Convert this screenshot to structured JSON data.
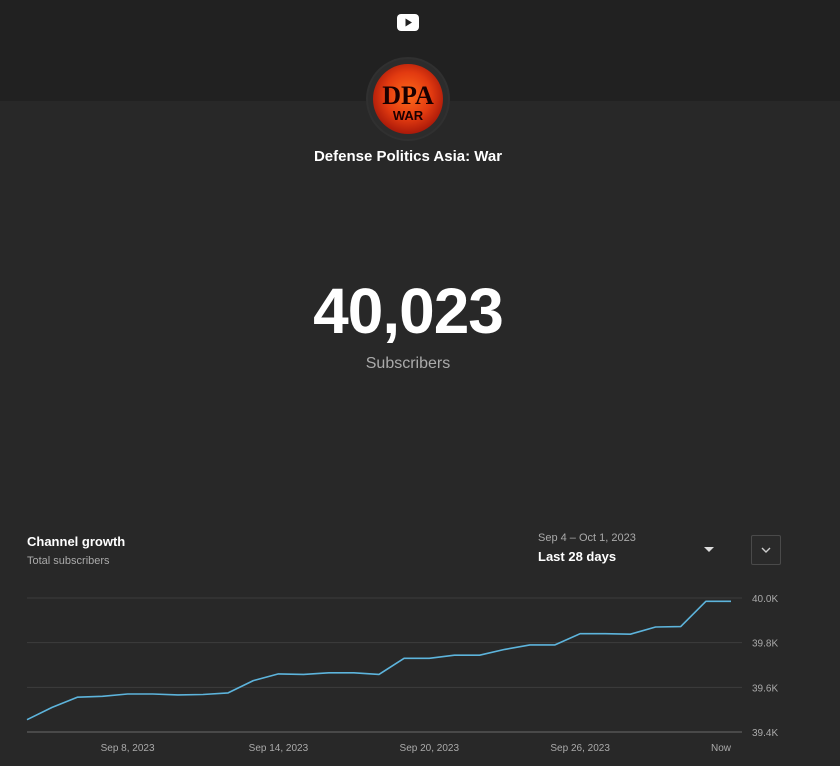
{
  "channel": {
    "name": "Defense Politics Asia: War",
    "avatar_text_top": "DPA",
    "avatar_text_bottom": "WAR"
  },
  "stats": {
    "subscriber_count": "40,023",
    "subscriber_label": "Subscribers"
  },
  "growth": {
    "title": "Channel growth",
    "subtitle": "Total subscribers",
    "date_range": "Sep 4 – Oct 1, 2023",
    "period_label": "Last 28 days"
  },
  "icons": {
    "logo": "youtube-play-icon",
    "period_dropdown": "caret-down-icon",
    "expand": "chevron-down-icon"
  },
  "colors": {
    "background": "#282828",
    "topbar": "#212121",
    "line": "#5db4dc",
    "grid": "#3d3d3d",
    "muted_text": "#aaaaaa"
  },
  "chart_data": {
    "type": "line",
    "title": "Channel growth",
    "subtitle": "Total subscribers",
    "xlabel": "",
    "ylabel": "",
    "ylim": [
      39400,
      40000
    ],
    "y_ticks": [
      "40.0K",
      "39.8K",
      "39.6K",
      "39.4K"
    ],
    "y_tick_values": [
      40000,
      39800,
      39600,
      39400
    ],
    "x_ticks": [
      "Sep 8, 2023",
      "Sep 14, 2023",
      "Sep 20, 2023",
      "Sep 26, 2023",
      "Now"
    ],
    "x_tick_index": [
      4,
      10,
      16,
      22,
      27.6
    ],
    "grid": true,
    "series": [
      {
        "values": [
          39455,
          39510,
          39556,
          39560,
          39570,
          39570,
          39566,
          39568,
          39575,
          39630,
          39660,
          39658,
          39665,
          39665,
          39658,
          39730,
          39730,
          39744,
          39744,
          39770,
          39790,
          39790,
          39840,
          39840,
          39838,
          39870,
          39872,
          39985,
          39985
        ]
      }
    ]
  }
}
